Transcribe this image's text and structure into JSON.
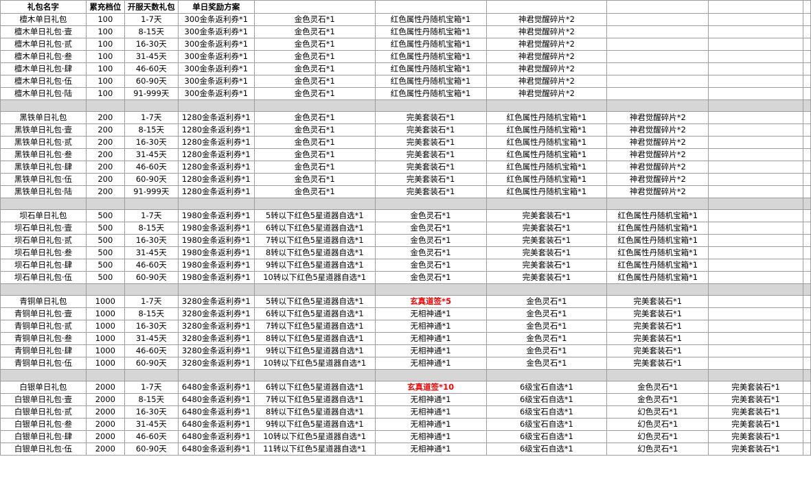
{
  "headers": [
    "礼包名字",
    "累充档位",
    "开服天数礼包",
    "单日奖励方案",
    "",
    "",
    "",
    "",
    "",
    ""
  ],
  "groups": [
    {
      "rows": [
        [
          "檀木单日礼包",
          "100",
          "1-7天",
          "300金条返利券*1",
          "金色灵石*1",
          "红色属性丹随机宝箱*1",
          "神君觉醒碎片*2",
          "",
          "",
          ""
        ],
        [
          "檀木单日礼包·壹",
          "100",
          "8-15天",
          "300金条返利券*1",
          "金色灵石*1",
          "红色属性丹随机宝箱*1",
          "神君觉醒碎片*2",
          "",
          "",
          ""
        ],
        [
          "檀木单日礼包·贰",
          "100",
          "16-30天",
          "300金条返利券*1",
          "金色灵石*1",
          "红色属性丹随机宝箱*1",
          "神君觉醒碎片*2",
          "",
          "",
          ""
        ],
        [
          "檀木单日礼包·叁",
          "100",
          "31-45天",
          "300金条返利券*1",
          "金色灵石*1",
          "红色属性丹随机宝箱*1",
          "神君觉醒碎片*2",
          "",
          "",
          ""
        ],
        [
          "檀木单日礼包·肆",
          "100",
          "46-60天",
          "300金条返利券*1",
          "金色灵石*1",
          "红色属性丹随机宝箱*1",
          "神君觉醒碎片*2",
          "",
          "",
          ""
        ],
        [
          "檀木单日礼包·伍",
          "100",
          "60-90天",
          "300金条返利券*1",
          "金色灵石*1",
          "红色属性丹随机宝箱*1",
          "神君觉醒碎片*2",
          "",
          "",
          ""
        ],
        [
          "檀木单日礼包·陆",
          "100",
          "91-999天",
          "300金条返利券*1",
          "金色灵石*1",
          "红色属性丹随机宝箱*1",
          "神君觉醒碎片*2",
          "",
          "",
          ""
        ]
      ]
    },
    {
      "rows": [
        [
          "黑铁单日礼包",
          "200",
          "1-7天",
          "1280金条返利券*1",
          "金色灵石*1",
          "完美套装石*1",
          "红色属性丹随机宝箱*1",
          "神君觉醒碎片*2",
          "",
          ""
        ],
        [
          "黑铁单日礼包·壹",
          "200",
          "8-15天",
          "1280金条返利券*1",
          "金色灵石*1",
          "完美套装石*1",
          "红色属性丹随机宝箱*1",
          "神君觉醒碎片*2",
          "",
          ""
        ],
        [
          "黑铁单日礼包·贰",
          "200",
          "16-30天",
          "1280金条返利券*1",
          "金色灵石*1",
          "完美套装石*1",
          "红色属性丹随机宝箱*1",
          "神君觉醒碎片*2",
          "",
          ""
        ],
        [
          "黑铁单日礼包·叁",
          "200",
          "31-45天",
          "1280金条返利券*1",
          "金色灵石*1",
          "完美套装石*1",
          "红色属性丹随机宝箱*1",
          "神君觉醒碎片*2",
          "",
          ""
        ],
        [
          "黑铁单日礼包·肆",
          "200",
          "46-60天",
          "1280金条返利券*1",
          "金色灵石*1",
          "完美套装石*1",
          "红色属性丹随机宝箱*1",
          "神君觉醒碎片*2",
          "",
          ""
        ],
        [
          "黑铁单日礼包·伍",
          "200",
          "60-90天",
          "1280金条返利券*1",
          "金色灵石*1",
          "完美套装石*1",
          "红色属性丹随机宝箱*1",
          "神君觉醒碎片*2",
          "",
          ""
        ],
        [
          "黑铁单日礼包·陆",
          "200",
          "91-999天",
          "1280金条返利券*1",
          "金色灵石*1",
          "完美套装石*1",
          "红色属性丹随机宝箱*1",
          "神君觉醒碎片*2",
          "",
          ""
        ]
      ]
    },
    {
      "rows": [
        [
          "坝石单日礼包",
          "500",
          "1-7天",
          "1980金条返利券*1",
          "5转以下红色5星道器自选*1",
          "金色灵石*1",
          "完美套装石*1",
          "红色属性丹随机宝箱*1",
          "",
          ""
        ],
        [
          "坝石单日礼包·壹",
          "500",
          "8-15天",
          "1980金条返利券*1",
          "6转以下红色5星道器自选*1",
          "金色灵石*1",
          "完美套装石*1",
          "红色属性丹随机宝箱*1",
          "",
          ""
        ],
        [
          "坝石单日礼包·贰",
          "500",
          "16-30天",
          "1980金条返利券*1",
          "7转以下红色5星道器自选*1",
          "金色灵石*1",
          "完美套装石*1",
          "红色属性丹随机宝箱*1",
          "",
          ""
        ],
        [
          "坝石单日礼包·叁",
          "500",
          "31-45天",
          "1980金条返利券*1",
          "8转以下红色5星道器自选*1",
          "金色灵石*1",
          "完美套装石*1",
          "红色属性丹随机宝箱*1",
          "",
          ""
        ],
        [
          "坝石单日礼包·肆",
          "500",
          "46-60天",
          "1980金条返利券*1",
          "9转以下红色5星道器自选*1",
          "金色灵石*1",
          "完美套装石*1",
          "红色属性丹随机宝箱*1",
          "",
          ""
        ],
        [
          "坝石单日礼包·伍",
          "500",
          "60-90天",
          "1980金条返利券*1",
          "10转以下红色5星道器自选*1",
          "金色灵石*1",
          "完美套装石*1",
          "红色属性丹随机宝箱*1",
          "",
          ""
        ]
      ]
    },
    {
      "rows": [
        [
          "青铜单日礼包",
          "1000",
          "1-7天",
          "3280金条返利券*1",
          "5转以下红色5星道器自选*1",
          "玄真道签*5",
          "金色灵石*1",
          "完美套装石*1",
          "",
          ""
        ],
        [
          "青铜单日礼包·壹",
          "1000",
          "8-15天",
          "3280金条返利券*1",
          "6转以下红色5星道器自选*1",
          "无相神通*1",
          "金色灵石*1",
          "完美套装石*1",
          "",
          ""
        ],
        [
          "青铜单日礼包·贰",
          "1000",
          "16-30天",
          "3280金条返利券*1",
          "7转以下红色5星道器自选*1",
          "无相神通*1",
          "金色灵石*1",
          "完美套装石*1",
          "",
          ""
        ],
        [
          "青铜单日礼包·叁",
          "1000",
          "31-45天",
          "3280金条返利券*1",
          "8转以下红色5星道器自选*1",
          "无相神通*1",
          "金色灵石*1",
          "完美套装石*1",
          "",
          ""
        ],
        [
          "青铜单日礼包·肆",
          "1000",
          "46-60天",
          "3280金条返利券*1",
          "9转以下红色5星道器自选*1",
          "无相神通*1",
          "金色灵石*1",
          "完美套装石*1",
          "",
          ""
        ],
        [
          "青铜单日礼包·伍",
          "1000",
          "60-90天",
          "3280金条返利券*1",
          "10转以下红色5星道器自选*1",
          "无相神通*1",
          "金色灵石*1",
          "完美套装石*1",
          "",
          ""
        ]
      ]
    },
    {
      "rows": [
        [
          "白银单日礼包",
          "2000",
          "1-7天",
          "6480金条返利券*1",
          "6转以下红色5星道器自选*1",
          "玄真道签*10",
          "6级宝石自选*1",
          "金色灵石*1",
          "完美套装石*1",
          ""
        ],
        [
          "白银单日礼包·壹",
          "2000",
          "8-15天",
          "6480金条返利券*1",
          "7转以下红色5星道器自选*1",
          "无相神通*1",
          "6级宝石自选*1",
          "金色灵石*1",
          "完美套装石*1",
          ""
        ],
        [
          "白银单日礼包·贰",
          "2000",
          "16-30天",
          "6480金条返利券*1",
          "8转以下红色5星道器自选*1",
          "无相神通*1",
          "6级宝石自选*1",
          "幻色灵石*1",
          "完美套装石*1",
          ""
        ],
        [
          "白银单日礼包·叁",
          "2000",
          "31-45天",
          "6480金条返利券*1",
          "9转以下红色5星道器自选*1",
          "无相神通*1",
          "6级宝石自选*1",
          "幻色灵石*1",
          "完美套装石*1",
          ""
        ],
        [
          "白银单日礼包·肆",
          "2000",
          "46-60天",
          "6480金条返利券*1",
          "10转以下红色5星道器自选*1",
          "无相神通*1",
          "6级宝石自选*1",
          "幻色灵石*1",
          "完美套装石*1",
          ""
        ],
        [
          "白银单日礼包·伍",
          "2000",
          "60-90天",
          "6480金条返利券*1",
          "11转以下红色5星道器自选*1",
          "无相神通*1",
          "6级宝石自选*1",
          "幻色灵石*1",
          "完美套装石*1",
          ""
        ]
      ]
    }
  ],
  "highlight_texts": [
    "玄真道签*5",
    "玄真道签*10"
  ],
  "colors": {
    "separator": "#d6d6d6",
    "grid": "#9b9b9b",
    "highlight": "#ff0000"
  }
}
